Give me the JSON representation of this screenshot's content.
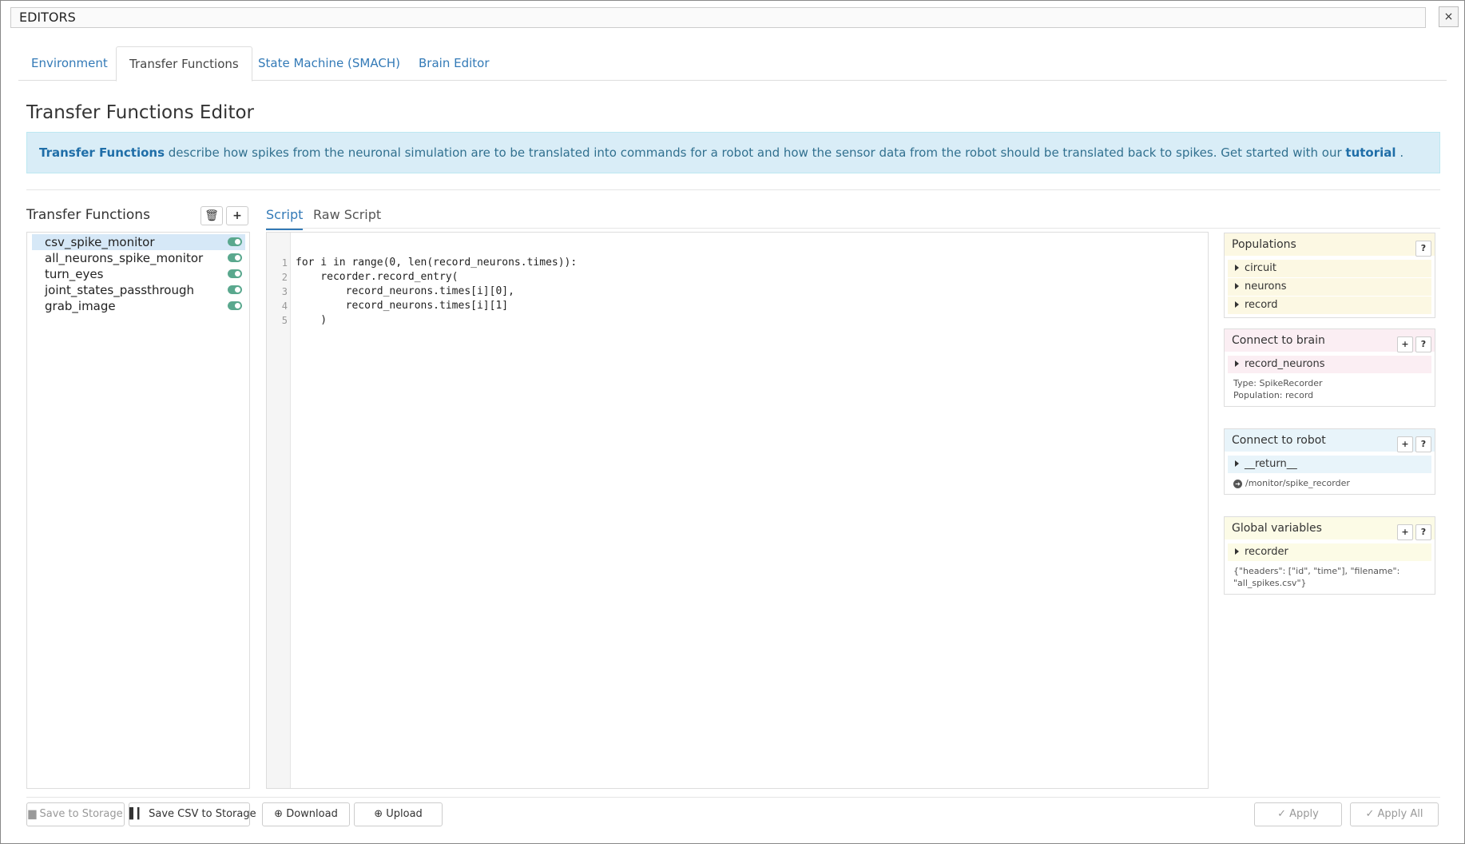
{
  "window": {
    "title": "EDITORS",
    "close_label": "×"
  },
  "tabs": [
    {
      "label": "Environment"
    },
    {
      "label": "Transfer Functions"
    },
    {
      "label": "State Machine (SMACH)"
    },
    {
      "label": "Brain Editor"
    }
  ],
  "page": {
    "title": "Transfer Functions Editor",
    "info_bold": "Transfer Functions",
    "info_text": " describe how spikes from the neuronal simulation are to be translated into commands for a robot and how the sensor data from the robot should be translated back to spikes. Get started with our ",
    "info_link": "tutorial",
    "info_end": " ."
  },
  "tf_panel": {
    "header": "Transfer Functions",
    "delete_icon": "🗑",
    "add_icon": "+",
    "items": [
      {
        "label": "csv_spike_monitor",
        "enabled": true
      },
      {
        "label": "all_neurons_spike_monitor",
        "enabled": true
      },
      {
        "label": "turn_eyes",
        "enabled": true
      },
      {
        "label": "joint_states_passthrough",
        "enabled": true
      },
      {
        "label": "grab_image",
        "enabled": true
      }
    ]
  },
  "editor_tabs": {
    "script": "Script",
    "raw": "Raw Script"
  },
  "code": [
    {
      "n": "1",
      "text": "for i in range(0, len(record_neurons.times)):"
    },
    {
      "n": "2",
      "text": "    recorder.record_entry("
    },
    {
      "n": "3",
      "text": "        record_neurons.times[i][0],"
    },
    {
      "n": "4",
      "text": "        record_neurons.times[i][1]"
    },
    {
      "n": "5",
      "text": "    )"
    }
  ],
  "populations": {
    "title": "Populations",
    "help": "?",
    "items": [
      "circuit",
      "neurons",
      "record"
    ],
    "color": "#fcf8e3"
  },
  "connect_brain": {
    "title": "Connect to brain",
    "add": "+",
    "help": "?",
    "item": "record_neurons",
    "type_line": "Type: SpikeRecorder",
    "population_line": "Population: record",
    "color": "#fbeef3"
  },
  "connect_robot": {
    "title": "Connect to robot",
    "add": "+",
    "help": "?",
    "item": "__return__",
    "topic": "/monitor/spike_recorder",
    "color": "#e8f4fa"
  },
  "global_vars": {
    "title": "Global variables",
    "add": "+",
    "help": "?",
    "item": "recorder",
    "value_line1": "{\"headers\": [\"id\", \"time\"], \"filename\":",
    "value_line2": "\"all_spikes.csv\"}",
    "color": "#fcfbe6"
  },
  "footer": {
    "save_storage": "Save to Storage",
    "save_csv": "Save CSV to Storage",
    "download": "Download",
    "upload": "Upload",
    "apply": "Apply",
    "apply_all": "Apply All"
  }
}
